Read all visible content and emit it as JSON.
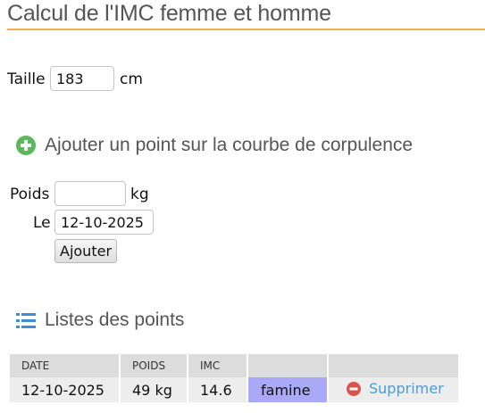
{
  "page_title": "Calcul de l'IMC femme et homme",
  "height_field": {
    "label": "Taille",
    "value": "183",
    "unit": "cm"
  },
  "add_section": {
    "title": "Ajouter un point sur la courbe de corpulence",
    "icon": "plus-circle-icon",
    "icon_color": "#5cb85c",
    "weight_label": "Poids",
    "weight_value": "",
    "weight_unit": "kg",
    "date_label": "Le",
    "date_value": "12-10-2025",
    "submit_label": "Ajouter"
  },
  "list_section": {
    "title": "Listes des points",
    "icon": "list-icon",
    "icon_color": "#3b8fd6",
    "columns": [
      "DATE",
      "POIDS",
      "IMC",
      "",
      ""
    ],
    "rows": [
      {
        "date": "12-10-2025",
        "weight": "49 kg",
        "bmi": "14.6",
        "category": "famine",
        "category_color": "#a9a9f8",
        "delete_label": "Supprimer"
      }
    ]
  },
  "colors": {
    "title_underline": "#f0b048",
    "delete_icon": "#d9534f",
    "link": "#4c9cd8"
  }
}
